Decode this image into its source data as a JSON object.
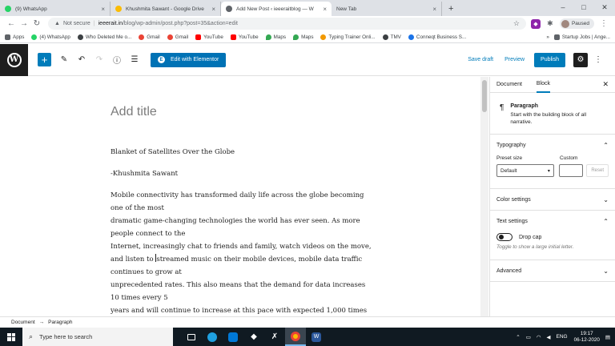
{
  "browser": {
    "tabs": [
      {
        "title": "(9) WhatsApp",
        "color": "#25d366",
        "active": false
      },
      {
        "title": "Khushmita Sawant - Google Drive",
        "color": "#fbbc04",
        "active": false
      },
      {
        "title": "Add New Post ‹ ieeeraitblog — W",
        "color": "#5f6368",
        "active": true
      },
      {
        "title": "New Tab",
        "color": "#ffffff",
        "active": false
      }
    ],
    "new_tab": "+",
    "security_label": "Not secure",
    "url_host": "ieeerait.in",
    "url_path": "/blog/wp-admin/post.php?post=35&action=edit",
    "profile_status": "Paused"
  },
  "bookmarks": [
    {
      "label": "Apps",
      "color": "#5f6368"
    },
    {
      "label": "(4) WhatsApp",
      "color": "#25d366"
    },
    {
      "label": "Who Deleted Me o...",
      "color": "#3c4043"
    },
    {
      "label": "Gmail",
      "color": "#ea4335"
    },
    {
      "label": "Gmail",
      "color": "#ea4335"
    },
    {
      "label": "YouTube",
      "color": "#ff0000"
    },
    {
      "label": "YouTube",
      "color": "#ff0000"
    },
    {
      "label": "Maps",
      "color": "#34a853"
    },
    {
      "label": "Maps",
      "color": "#34a853"
    },
    {
      "label": "Typing Trainer Onli...",
      "color": "#f29900"
    },
    {
      "label": "TMV",
      "color": "#3c4043"
    },
    {
      "label": "Conneqt Business S...",
      "color": "#1a73e8"
    }
  ],
  "bookmarks_right": "Startup Jobs | Ange...",
  "wp_toolbar": {
    "add_block": "+",
    "edit_with_elementor": "Edit with Elementor",
    "save_draft": "Save draft",
    "preview": "Preview",
    "publish": "Publish"
  },
  "editor": {
    "title_placeholder": "Add title",
    "paragraphs": [
      "Blanket of Satellites Over the Globe",
      "-Khushmita Sawant",
      "Mobile connectivity has transformed daily life across the globe becoming one of the most",
      "dramatic game-changing technologies the world has ever seen. As more people connect to the",
      "Internet, increasingly chat to friends and family, watch videos on the move,",
      "and listen to ",
      "streamed music on their mobile devices, mobile data traffic continues to grow at",
      "unprecedented rates. This also means that the demand for data increases 10 times every 5",
      "years and will continue to increase at this pace with expected 1,000 times"
    ]
  },
  "sidebar": {
    "tab_document": "Document",
    "tab_block": "Block",
    "block_name": "Paragraph",
    "block_desc": "Start with the building block of all narrative.",
    "typography_title": "Typography",
    "preset_size_label": "Preset size",
    "custom_label": "Custom",
    "preset_value": "Default",
    "reset_label": "Reset",
    "color_settings": "Color settings",
    "text_settings": "Text settings",
    "drop_cap_label": "Drop cap",
    "drop_cap_help": "Toggle to show a large initial letter.",
    "advanced": "Advanced"
  },
  "footer": {
    "crumb_document": "Document",
    "arrow": "→",
    "crumb_paragraph": "Paragraph"
  },
  "taskbar": {
    "search_placeholder": "Type here to search",
    "language": "ENG",
    "time": "19:17",
    "date": "06-12-2020"
  },
  "colors": {
    "wp_blue": "#007cba",
    "elementor_blue": "#0072b5",
    "taskbar": "#101a22"
  }
}
